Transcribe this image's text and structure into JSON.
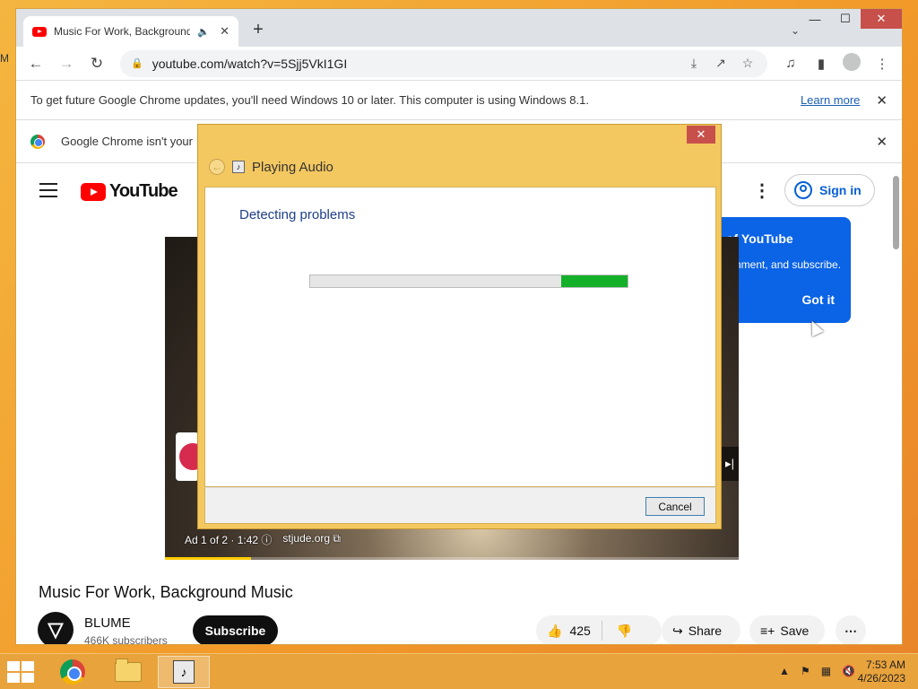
{
  "desktop": {
    "edge_letter": "M"
  },
  "browser": {
    "tab_title": "Music For Work, Background Music",
    "new_tab_glyph": "+",
    "url": "youtube.com/watch?v=5Sjj5VkI1GI",
    "infobar_text": "To get future Google Chrome updates, you'll need Windows 10 or later. This computer is using Windows 8.1.",
    "infobar_link": "Learn more",
    "infobar2_text": "Google Chrome isn't your"
  },
  "youtube": {
    "logo_text": "YouTube",
    "signin": "Sign in",
    "tooltip_title": "of YouTube",
    "tooltip_text": "omment, and subscribe.",
    "tooltip_button": "Got it",
    "ad_info": "Ad 1 of 2 · 1:42 ⓘ",
    "ad_site": "stjude.org ⧉",
    "video_title": "Music For Work, Background Music",
    "channel_name": "BLUME",
    "subscribers": "466K subscribers",
    "subscribe_label": "Subscribe",
    "like_count": "425",
    "share_label": "Share",
    "save_label": "Save",
    "video_progress": 0.15
  },
  "dialog": {
    "title": "Playing Audio",
    "status": "Detecting problems",
    "cancel_label": "Cancel",
    "progress_segment": {
      "start": 0.79,
      "end": 1.0,
      "color": "#14b02a"
    }
  },
  "taskbar": {
    "time": "7:53 AM",
    "date": "4/26/2023"
  },
  "colors": {
    "desktop_accent": "#f29a2a",
    "youtube_red": "#ff0000",
    "tooltip_blue": "#0b63e5",
    "link_blue": "#065fd4"
  }
}
